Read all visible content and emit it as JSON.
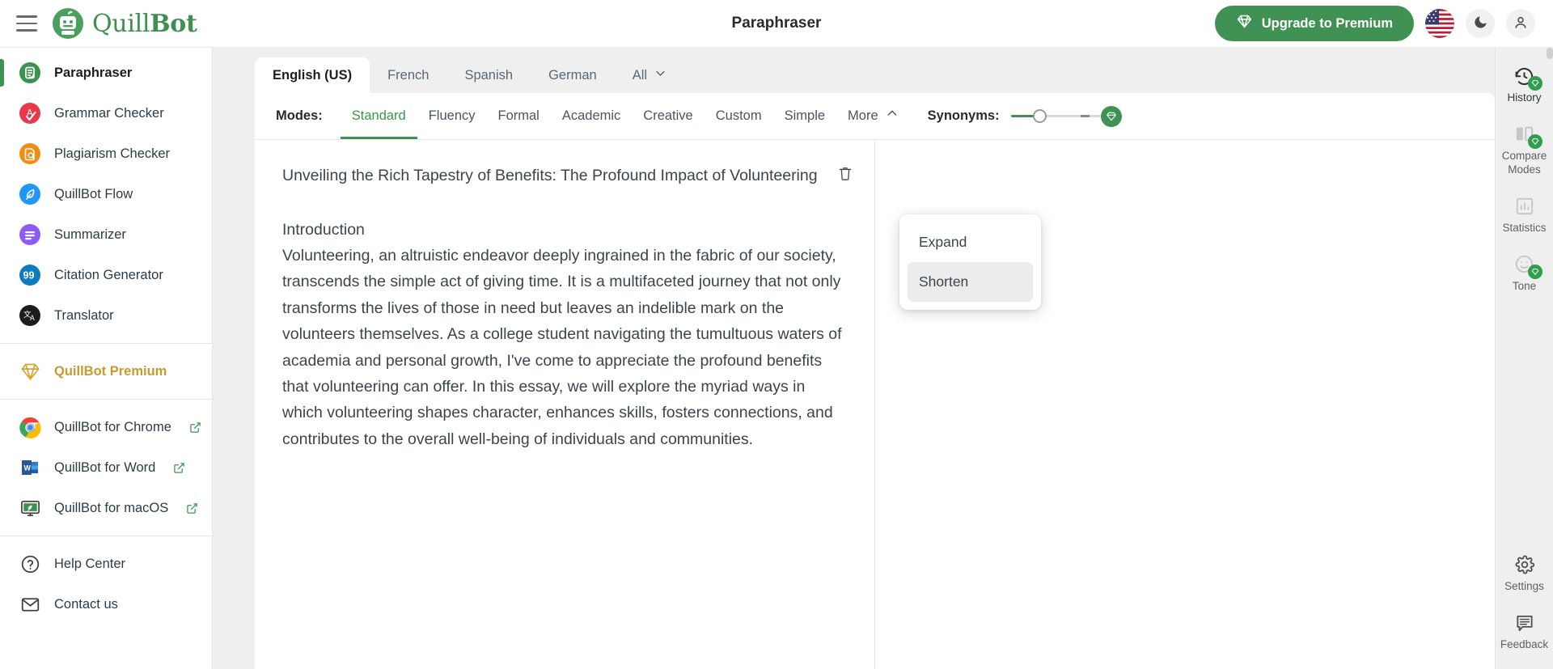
{
  "header": {
    "title": "Paraphraser",
    "brand": "QuillBot",
    "brand_part1": "Quill",
    "brand_part2": "Bot",
    "menu_icon": "hamburger-menu-icon",
    "upgrade_label": "Upgrade to Premium",
    "upgrade_icon": "diamond-icon",
    "flag_icon": "us-flag-icon",
    "dark_mode_icon": "moon-icon",
    "account_icon": "person-icon",
    "accent_green": "#3f9253"
  },
  "sidebar": {
    "items": [
      {
        "label": "Paraphraser",
        "icon": "paraphraser-icon",
        "color": "#3c9150",
        "active": true
      },
      {
        "label": "Grammar Checker",
        "icon": "grammar-checker-icon",
        "color": "#e8394a",
        "active": false
      },
      {
        "label": "Plagiarism Checker",
        "icon": "plagiarism-checker-icon",
        "color": "#f28d12",
        "active": false
      },
      {
        "label": "QuillBot Flow",
        "icon": "flow-icon",
        "color": "#2196f3",
        "active": false
      },
      {
        "label": "Summarizer",
        "icon": "summarizer-icon",
        "color": "#8b5cf6",
        "active": false
      },
      {
        "label": "Citation Generator",
        "icon": "citation-generator-icon",
        "color": "#0f7bbf",
        "active": false
      },
      {
        "label": "Translator",
        "icon": "translator-icon",
        "color": "#1c1c1c",
        "active": false
      }
    ],
    "premium": {
      "label": "QuillBot Premium",
      "icon": "diamond-icon",
      "color": "#c79a2b"
    },
    "apps": [
      {
        "label": "QuillBot for Chrome",
        "icon": "chrome-icon"
      },
      {
        "label": "QuillBot for Word",
        "icon": "word-icon"
      },
      {
        "label": "QuillBot for macOS",
        "icon": "macos-icon"
      }
    ],
    "support": [
      {
        "label": "Help Center",
        "icon": "help-circle-icon"
      },
      {
        "label": "Contact us",
        "icon": "envelope-icon"
      }
    ]
  },
  "language_tabs": {
    "items": [
      {
        "label": "English (US)",
        "active": true
      },
      {
        "label": "French",
        "active": false
      },
      {
        "label": "Spanish",
        "active": false
      },
      {
        "label": "German",
        "active": false
      }
    ],
    "all_label": "All",
    "all_chevron": "chevron-down-icon"
  },
  "modes": {
    "label": "Modes:",
    "items": [
      {
        "label": "Standard",
        "active": true
      },
      {
        "label": "Fluency",
        "active": false
      },
      {
        "label": "Formal",
        "active": false
      },
      {
        "label": "Academic",
        "active": false
      },
      {
        "label": "Creative",
        "active": false
      },
      {
        "label": "Custom",
        "active": false
      },
      {
        "label": "Simple",
        "active": false
      }
    ],
    "more_label": "More",
    "more_chevron": "chevron-up-icon"
  },
  "synonyms": {
    "label": "Synonyms:",
    "premium_icon": "diamond-icon",
    "value_position_percent": 25
  },
  "dropdown": {
    "items": [
      {
        "label": "Expand",
        "hovered": false
      },
      {
        "label": "Shorten",
        "hovered": true
      }
    ]
  },
  "editor": {
    "delete_icon": "trash-icon",
    "title": "Unveiling the Rich Tapestry of Benefits: The Profound Impact of Volunteering",
    "section_heading": "Introduction",
    "body": "Volunteering, an altruistic endeavor deeply ingrained in the fabric of our society, transcends the simple act of giving time. It is a multifaceted journey that not only transforms the lives of those in need but leaves an indelible mark on the volunteers themselves. As a college student navigating the tumultuous waters of academia and personal growth, I've come to appreciate the profound benefits that volunteering can offer. In this essay, we will explore the myriad ways in which volunteering shapes character, enhances skills, fosters connections, and contributes to the overall well-being of individuals and communities."
  },
  "rail": {
    "top_items": [
      {
        "label": "History",
        "icon": "history-clock-icon",
        "premium": true,
        "emphasis": "dark"
      },
      {
        "label": "Compare\nModes",
        "label_line1": "Compare",
        "label_line2": "Modes",
        "icon": "compare-modes-icon",
        "premium": true,
        "emphasis": "muted"
      },
      {
        "label": "Statistics",
        "icon": "statistics-bars-icon",
        "premium": false,
        "emphasis": "muted"
      },
      {
        "label": "Tone",
        "icon": "tone-smiley-icon",
        "premium": true,
        "emphasis": "muted"
      }
    ],
    "bottom_items": [
      {
        "label": "Settings",
        "icon": "gear-icon"
      },
      {
        "label": "Feedback",
        "icon": "speech-bubble-icon"
      }
    ]
  }
}
